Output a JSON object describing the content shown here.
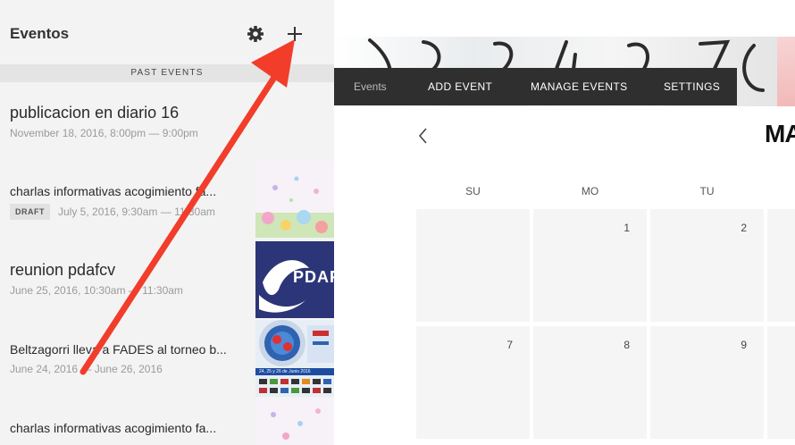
{
  "panel": {
    "title": "Eventos",
    "section_label": "PAST EVENTS",
    "events": [
      {
        "title": "publicacion en diario 16",
        "date": "November 18, 2016, 8:00pm — 9:00pm"
      },
      {
        "title": "charlas informativas acogimiento fa...",
        "badge": "DRAFT",
        "date": "July 5, 2016, 9:30am — 11:30am"
      },
      {
        "title": "reunion pdafcv",
        "date": "June 25, 2016, 10:30am — 11:30am"
      },
      {
        "title": "Beltzagorri lleva a FADES al torneo b...",
        "date": "June 24, 2016 — June 26, 2016"
      },
      {
        "title": "charlas informativas acogimiento fa..."
      }
    ],
    "thumbs": {
      "pdaf_text": "PDAF",
      "torneo_text": "24, 25 y 26 de Junio 2016"
    }
  },
  "nav": {
    "events": "Events",
    "add_event": "ADD EVENT",
    "manage_events": "MANAGE EVENTS",
    "settings": "SETTINGS"
  },
  "calendar": {
    "month": "MA",
    "days_of_week": [
      "SU",
      "MO",
      "TU"
    ],
    "week1": [
      "",
      "1",
      "2"
    ],
    "week2": [
      "7",
      "8",
      "9"
    ]
  },
  "icons": {
    "gear": "gear-icon",
    "add": "plus-icon",
    "prev": "chevron-left-icon"
  },
  "colors": {
    "panel_bg": "#f3f3f3",
    "nav_bg": "#2f2f2f",
    "arrow": "#f23d2b",
    "cell_bg": "#f5f5f5"
  }
}
